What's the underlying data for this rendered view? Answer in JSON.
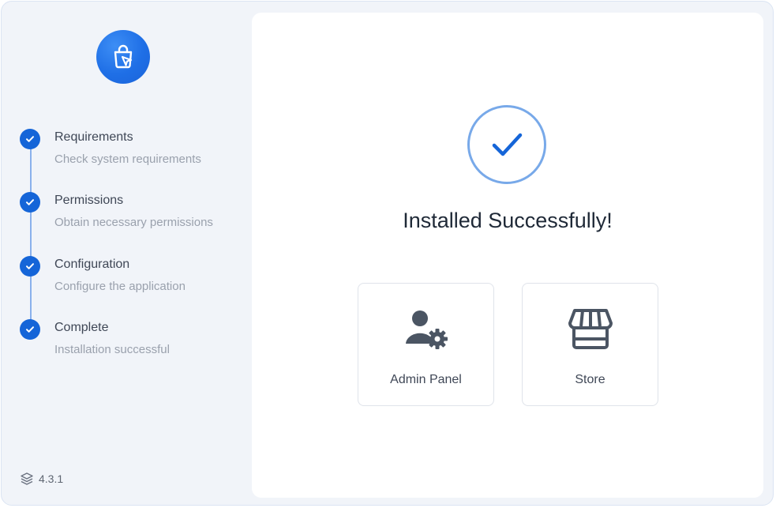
{
  "sidebar": {
    "logo": {
      "icon": "shopping-bag-cursor-icon",
      "color": "#1f6fe6"
    },
    "steps": [
      {
        "title": "Requirements",
        "desc": "Check system requirements",
        "status": "done"
      },
      {
        "title": "Permissions",
        "desc": "Obtain necessary permissions",
        "status": "done"
      },
      {
        "title": "Configuration",
        "desc": "Configure the application",
        "status": "done"
      },
      {
        "title": "Complete",
        "desc": "Installation successful",
        "status": "done"
      }
    ],
    "version": "4.3.1",
    "version_icon": "layers-icon"
  },
  "main": {
    "success_icon": "checkmark-icon",
    "headline": "Installed Successfully!",
    "actions": [
      {
        "label": "Admin Panel",
        "icon": "admin-user-gear-icon"
      },
      {
        "label": "Store",
        "icon": "storefront-icon"
      }
    ]
  },
  "colors": {
    "accent": "#1565d8",
    "ring": "#78a9e9",
    "icon_gray": "#4b5563"
  }
}
